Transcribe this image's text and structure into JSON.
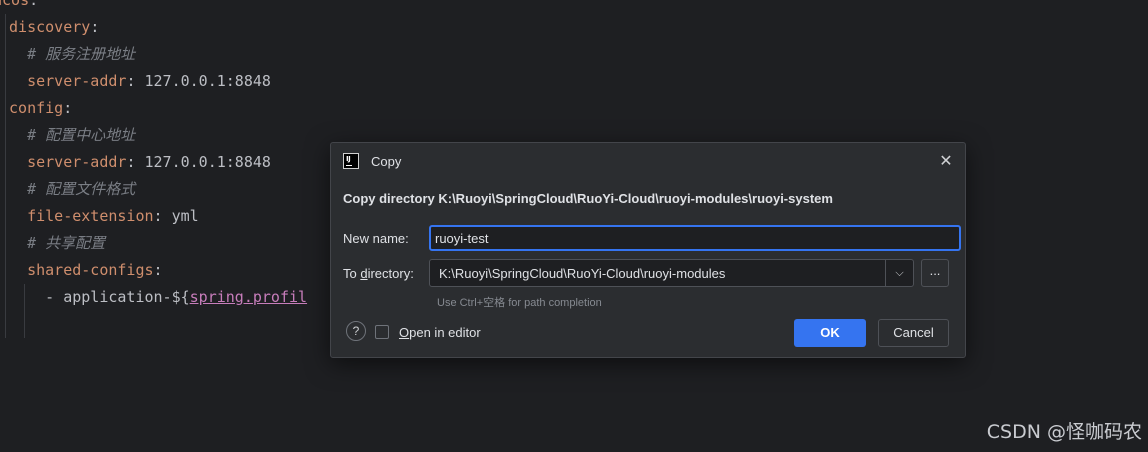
{
  "editor": {
    "lines": [
      {
        "indent": "",
        "key": "acos",
        "colon": ":",
        "value": ""
      },
      {
        "indent": " ",
        "key": "discovery",
        "colon": ":",
        "value": ""
      },
      {
        "indent": "   ",
        "comment": "# 服务注册地址"
      },
      {
        "indent": "   ",
        "key": "server-addr",
        "colon": ":",
        "value": " 127.0.0.1:8848"
      },
      {
        "indent": " ",
        "key": "config",
        "colon": ":",
        "value": ""
      },
      {
        "indent": "   ",
        "comment": "# 配置中心地址"
      },
      {
        "indent": "   ",
        "key": "server-addr",
        "colon": ":",
        "value": " 127.0.0.1:8848"
      },
      {
        "indent": "   ",
        "comment": "# 配置文件格式"
      },
      {
        "indent": "   ",
        "key": "file-extension",
        "colon": ":",
        "value": " yml"
      },
      {
        "indent": "   ",
        "comment": "# 共享配置"
      },
      {
        "indent": "   ",
        "key": "shared-configs",
        "colon": ":",
        "value": ""
      },
      {
        "indent": "     ",
        "prefix": "- application-${",
        "link": "spring.profil"
      }
    ]
  },
  "dialog": {
    "title": "Copy",
    "close_symbol": "✕",
    "headline": "Copy directory K:\\Ruoyi\\SpringCloud\\RuoYi-Cloud\\ruoyi-modules\\ruoyi-system",
    "new_name_label": "New name:",
    "new_name_value": "ruoyi-test",
    "to_directory_label_prefix": "To ",
    "to_directory_label_mnemonic": "d",
    "to_directory_label_rest": "irectory:",
    "to_directory_value": "K:\\Ruoyi\\SpringCloud\\RuoYi-Cloud\\ruoyi-modules",
    "combo_arrow": "⌵",
    "browse_label": "...",
    "hint": "Use Ctrl+空格 for path completion",
    "help_symbol": "?",
    "open_in_editor_mnemonic": "O",
    "open_in_editor_rest": "pen in editor",
    "open_in_editor_checked": false,
    "ok_label": "OK",
    "cancel_label": "Cancel"
  },
  "watermark": "CSDN @怪咖码农",
  "colors": {
    "editor_bg": "#1e1f22",
    "dialog_bg": "#2b2d30",
    "accent": "#3574f0",
    "yaml_key": "#cf8e6d",
    "comment": "#7a7e85"
  }
}
